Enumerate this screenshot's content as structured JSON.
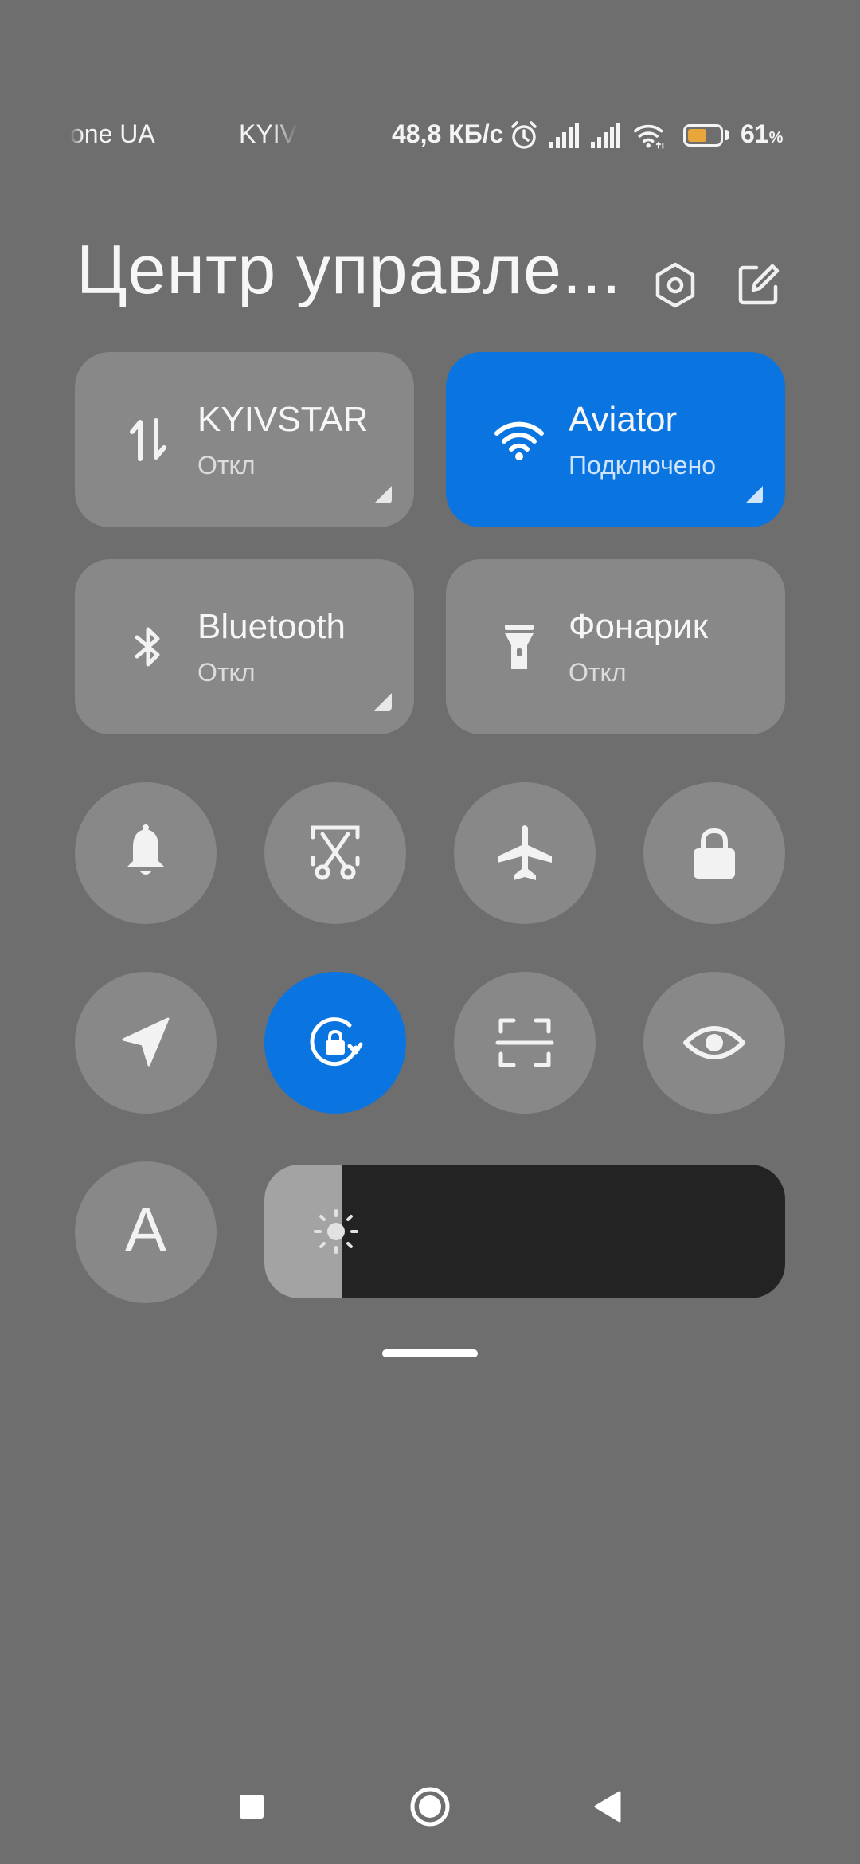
{
  "status_bar": {
    "carrier_1": "one UA",
    "carrier_2": "KYIV",
    "network_speed": "48,8 КБ/с",
    "battery_percent": "61",
    "battery_unit": "%",
    "battery_level": 0.61,
    "icons": [
      "alarm-icon",
      "signal-icon",
      "signal-icon",
      "wifi-icon",
      "battery-icon"
    ]
  },
  "header": {
    "title": "Центр управле...",
    "icons": [
      "settings-icon",
      "edit-icon"
    ]
  },
  "tiles": [
    {
      "name": "KYIVSTAR",
      "status": "Откл",
      "icon": "mobile-data-icon",
      "active": false
    },
    {
      "name": "Aviator",
      "status": "Подключено",
      "icon": "wifi-icon",
      "active": true
    },
    {
      "name": "Bluetooth",
      "status": "Откл",
      "icon": "bluetooth-icon",
      "active": false
    },
    {
      "name": "Фонарик",
      "status": "Откл",
      "icon": "flashlight-icon",
      "active": false
    }
  ],
  "toggles": [
    {
      "icon": "bell-icon",
      "active": false
    },
    {
      "icon": "screenshot-icon",
      "active": false
    },
    {
      "icon": "airplane-icon",
      "active": false
    },
    {
      "icon": "lock-icon",
      "active": false
    },
    {
      "icon": "location-icon",
      "active": false
    },
    {
      "icon": "rotation-lock-icon",
      "active": true
    },
    {
      "icon": "scanner-icon",
      "active": false
    },
    {
      "icon": "eye-icon",
      "active": false
    }
  ],
  "auto_brightness": {
    "label": "A"
  },
  "brightness": {
    "level": 0.15,
    "icon": "sun-icon"
  },
  "nav_bar": {
    "icons": [
      "recents-icon",
      "home-icon",
      "back-icon"
    ]
  },
  "colors": {
    "background": "#6e6e6e",
    "tile": "#888888",
    "active": "#0a74e0",
    "battery": "#e9a63b"
  }
}
